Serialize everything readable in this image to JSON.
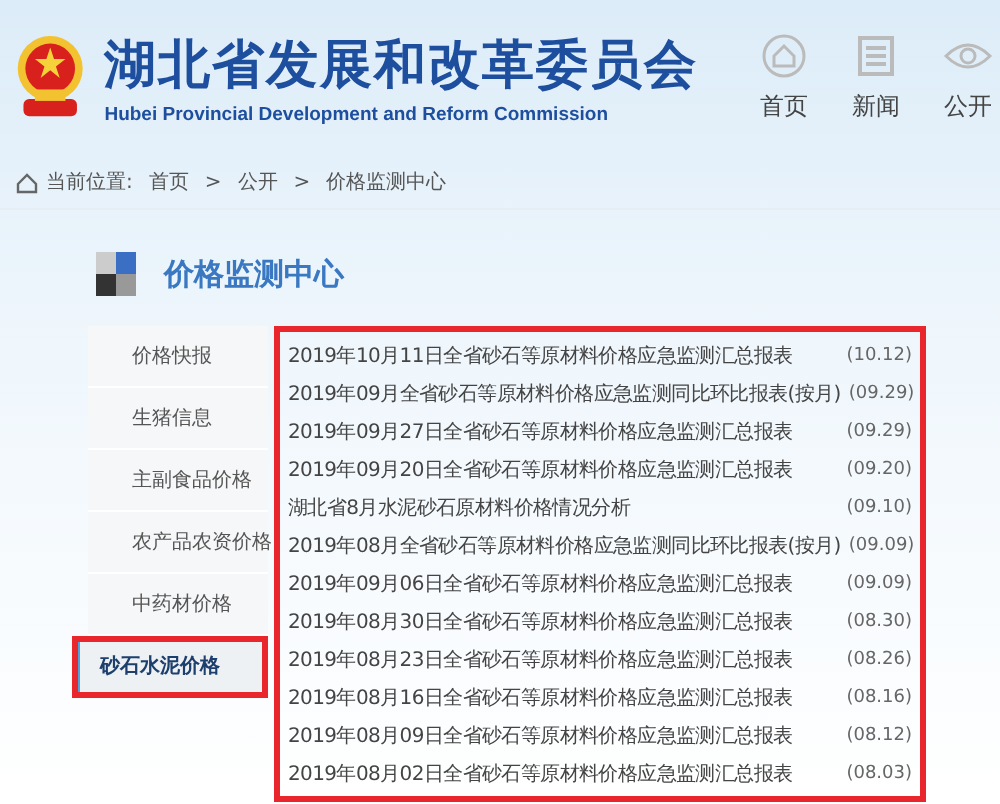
{
  "header": {
    "title": "湖北省发展和改革委员会",
    "subtitle": "Hubei Provincial Development and Reform Commission",
    "nav": [
      {
        "label": "首页",
        "kind": "home"
      },
      {
        "label": "新闻",
        "kind": "news"
      },
      {
        "label": "公开",
        "kind": "open"
      }
    ]
  },
  "breadcrumb": {
    "label": "当前位置:",
    "items": [
      "首页",
      "公开",
      "价格监测中心"
    ],
    "separator": ">"
  },
  "section_title": "价格监测中心",
  "sidebar": {
    "items": [
      {
        "label": "价格快报",
        "selected": false,
        "highlighted": false
      },
      {
        "label": "生猪信息",
        "selected": false,
        "highlighted": false
      },
      {
        "label": "主副食品价格",
        "selected": false,
        "highlighted": false
      },
      {
        "label": "农产品农资价格",
        "selected": false,
        "highlighted": false
      },
      {
        "label": "中药材价格",
        "selected": false,
        "highlighted": false
      },
      {
        "label": "砂石水泥价格",
        "selected": true,
        "highlighted": true
      }
    ]
  },
  "list": {
    "highlighted": true,
    "items": [
      {
        "title": "2019年10月11日全省砂石等原材料价格应急监测汇总报表",
        "date": "(10.12)"
      },
      {
        "title": "2019年09月全省砂石等原材料价格应急监测同比环比报表(按月)",
        "date": "(09.29)"
      },
      {
        "title": "2019年09月27日全省砂石等原材料价格应急监测汇总报表",
        "date": "(09.29)"
      },
      {
        "title": "2019年09月20日全省砂石等原材料价格应急监测汇总报表",
        "date": "(09.20)"
      },
      {
        "title": "湖北省8月水泥砂石原材料价格情况分析",
        "date": "(09.10)"
      },
      {
        "title": "2019年08月全省砂石等原材料价格应急监测同比环比报表(按月)",
        "date": "(09.09)"
      },
      {
        "title": "2019年09月06日全省砂石等原材料价格应急监测汇总报表",
        "date": "(09.09)"
      },
      {
        "title": "2019年08月30日全省砂石等原材料价格应急监测汇总报表",
        "date": "(08.30)"
      },
      {
        "title": "2019年08月23日全省砂石等原材料价格应急监测汇总报表",
        "date": "(08.26)"
      },
      {
        "title": "2019年08月16日全省砂石等原材料价格应急监测汇总报表",
        "date": "(08.16)"
      },
      {
        "title": "2019年08月09日全省砂石等原材料价格应急监测汇总报表",
        "date": "(08.12)"
      },
      {
        "title": "2019年08月02日全省砂石等原材料价格应急监测汇总报表",
        "date": "(08.03)"
      }
    ]
  }
}
